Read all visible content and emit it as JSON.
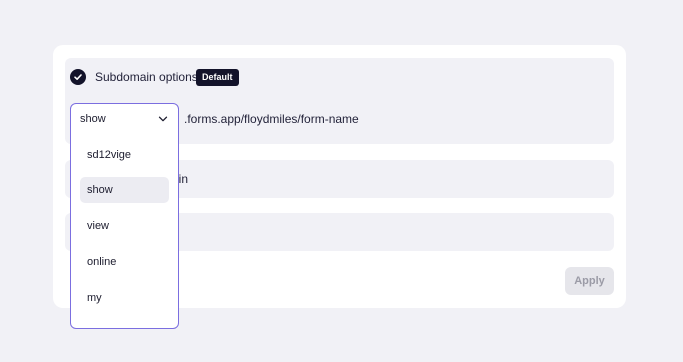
{
  "subdomain": {
    "title": "Subdomain options",
    "badge": "Default",
    "selected_value": "show",
    "suffix": ".forms.app/floydmiles/form-name",
    "options": [
      "sd12vige",
      "show",
      "view",
      "online",
      "my"
    ]
  },
  "row2": {
    "visible_text": "ain"
  },
  "apply_label": "Apply",
  "icons": {
    "check": "check-circle-icon",
    "chevron": "chevron-down-icon"
  },
  "colors": {
    "accent_border": "#7b6ee0",
    "badge_bg": "#13132a",
    "selected_option_bg": "#ececf2"
  }
}
